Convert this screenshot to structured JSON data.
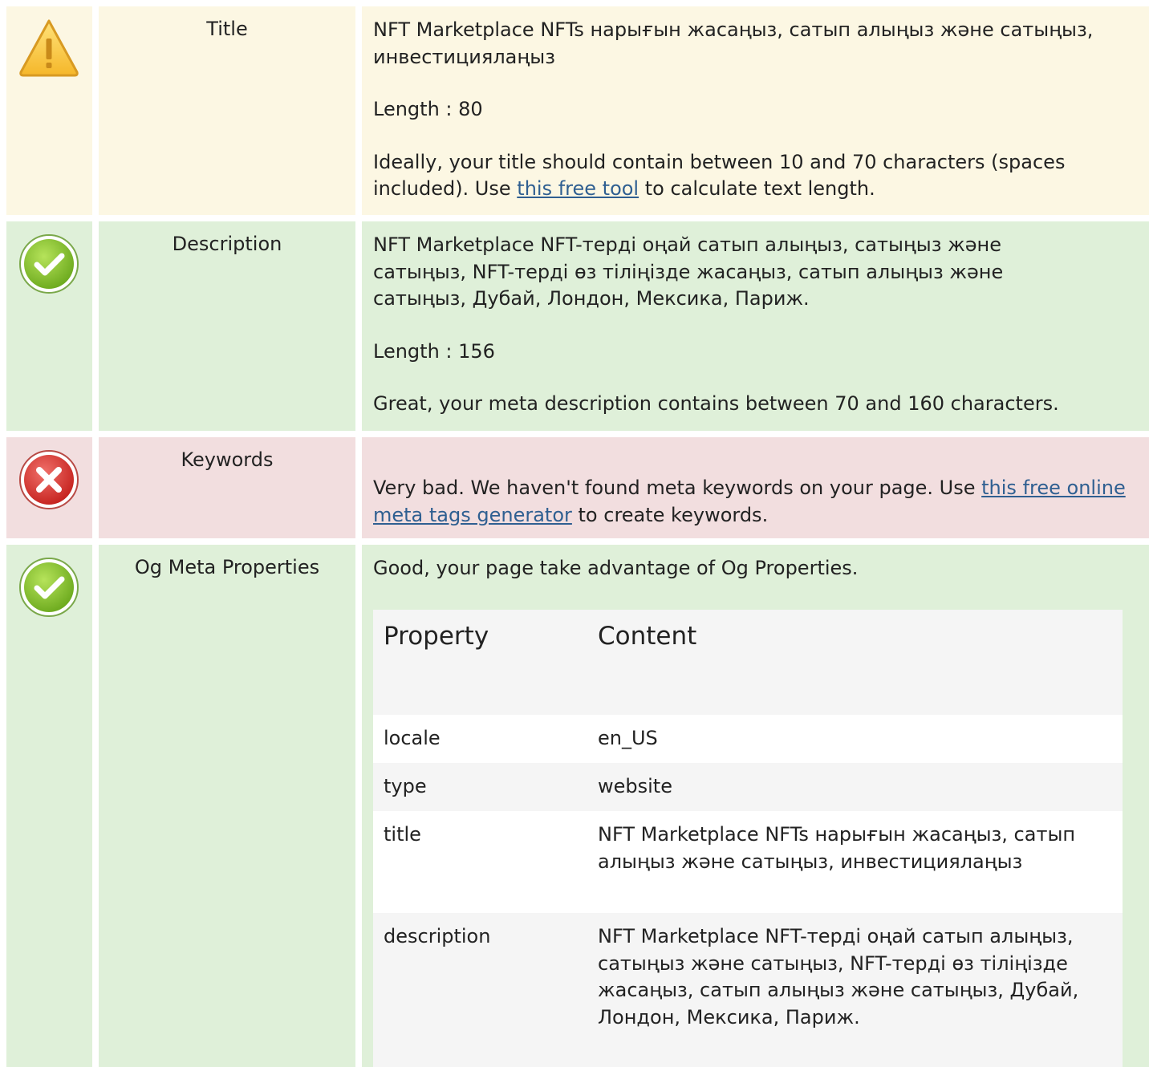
{
  "rows": {
    "title": {
      "status_icon": "warning-icon",
      "label": "Title",
      "value": "NFT Marketplace NFTs нарығын жасаңыз, сатып алыңыз және сатыңыз, инвестициялаңыз",
      "length": "Length : 80",
      "advice_before": "Ideally, your title should contain between 10 and 70 characters (spaces included). Use ",
      "advice_link": "this free tool",
      "advice_after": " to calculate text length."
    },
    "description": {
      "status_icon": "check-icon",
      "label": "Description",
      "value": "NFT Marketplace NFT-терді оңай сатып алыңыз, сатыңыз және сатыңыз, NFT-терді өз тіліңізде жасаңыз, сатып алыңыз және сатыңыз, Дубай, Лондон, Мексика, Париж.",
      "length": "Length : 156",
      "advice": "Great, your meta description contains between 70 and 160 characters."
    },
    "keywords": {
      "status_icon": "error-icon",
      "label": "Keywords",
      "advice_before": "Very bad. We haven't found meta keywords on your page. Use ",
      "advice_link": "this free online meta tags generator",
      "advice_after": " to create keywords."
    },
    "og": {
      "status_icon": "check-icon",
      "label": "Og Meta Properties",
      "advice": "Good, your page take advantage of Og Properties.",
      "table": {
        "header": {
          "property": "Property",
          "content": "Content"
        },
        "rows": [
          {
            "property": "locale",
            "content": "en_US"
          },
          {
            "property": "type",
            "content": "website"
          },
          {
            "property": "title",
            "content": "NFT Marketplace NFTs нарығын жасаңыз, сатып алыңыз және сатыңыз, инвестициялаңыз"
          },
          {
            "property": "description",
            "content": "NFT Marketplace NFT-терді оңай сатып алыңыз, сатыңыз және сатыңыз, NFT-терді өз тіліңізде жасаңыз, сатып алыңыз және сатыңыз, Дубай, Лондон, Мексика, Париж."
          }
        ]
      }
    }
  },
  "colors": {
    "warning_bg": "#fcf7e3",
    "ok_bg": "#dff0d9",
    "bad_bg": "#f2dedf",
    "link": "#2f5f91"
  }
}
